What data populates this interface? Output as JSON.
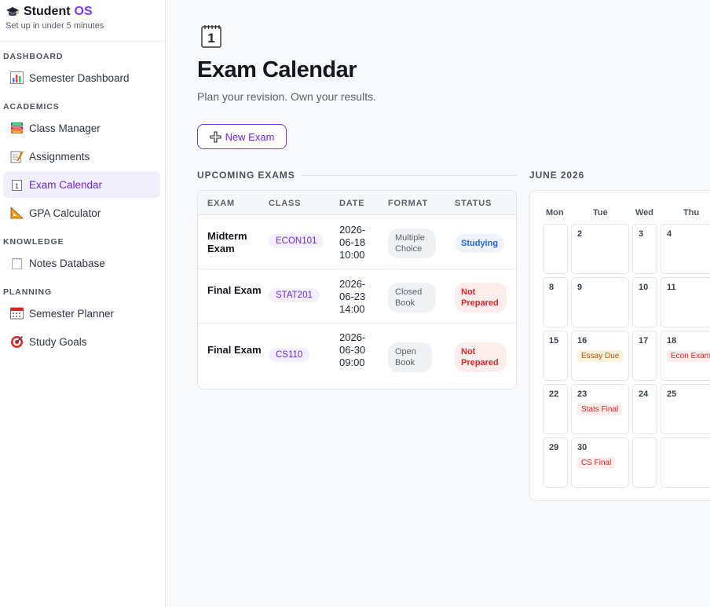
{
  "brand": {
    "name": "Student",
    "name_accent": "OS",
    "subtitle": "Set up in under 5 minutes"
  },
  "sidebar": {
    "sections": [
      {
        "label": "DASHBOARD"
      },
      {
        "label": "ACADEMICS"
      },
      {
        "label": "KNOWLEDGE"
      },
      {
        "label": "PLANNING"
      }
    ],
    "items": [
      {
        "label": "Semester Dashboard",
        "icon": "bar-chart-icon"
      },
      {
        "label": "Class Manager",
        "icon": "books-icon"
      },
      {
        "label": "Assignments",
        "icon": "memo-icon"
      },
      {
        "label": "Exam Calendar",
        "icon": "calendar-icon",
        "active": true
      },
      {
        "label": "GPA Calculator",
        "icon": "triangle-ruler-icon"
      },
      {
        "label": "Notes Database",
        "icon": "notepad-icon"
      },
      {
        "label": "Semester Planner",
        "icon": "planner-calendar-icon"
      },
      {
        "label": "Study Goals",
        "icon": "target-icon"
      }
    ]
  },
  "page": {
    "title": "Exam Calendar",
    "subtitle": "Plan your revision. Own your results.",
    "new_button": "New Exam",
    "upcoming_label": "UPCOMING EXAMS",
    "calendar_label": "JUNE 2026"
  },
  "table": {
    "columns": [
      "EXAM",
      "CLASS",
      "DATE",
      "FORMAT",
      "STATUS"
    ],
    "rows": [
      {
        "exam": "Midterm Exam",
        "class": "ECON101",
        "date": "2026-06-18 10:00",
        "format": "Multiple Choice",
        "status": "Studying"
      },
      {
        "exam": "Final Exam",
        "class": "STAT201",
        "date": "2026-06-23 14:00",
        "format": "Closed Book",
        "status": "Not Prepared"
      },
      {
        "exam": "Final Exam",
        "class": "CS110",
        "date": "2026-06-30 09:00",
        "format": "Open Book",
        "status": "Not Prepared"
      }
    ]
  },
  "calendar": {
    "weekdays": [
      "Mon",
      "Tue",
      "Wed",
      "Thu"
    ],
    "weeks": [
      [
        "",
        "2",
        "3",
        "4"
      ],
      [
        "8",
        "9",
        "10",
        "11"
      ],
      [
        "15",
        "16",
        "17",
        "18"
      ],
      [
        "22",
        "23",
        "24",
        "25"
      ],
      [
        "29",
        "30",
        "",
        ""
      ]
    ],
    "events": {
      "16": {
        "label": "Essay Due",
        "color": "#b45309"
      },
      "18": {
        "label": "Econ Exam",
        "color": "#dc2626"
      },
      "23": {
        "label": "Stats Final",
        "color": "#dc2626"
      },
      "30": {
        "label": "CS Final",
        "color": "#dc2626"
      }
    }
  },
  "colors": {
    "accent": "#7c3aed",
    "studying": "#2563eb",
    "not_prepared": "#dc2626",
    "essay": "#b45309"
  }
}
